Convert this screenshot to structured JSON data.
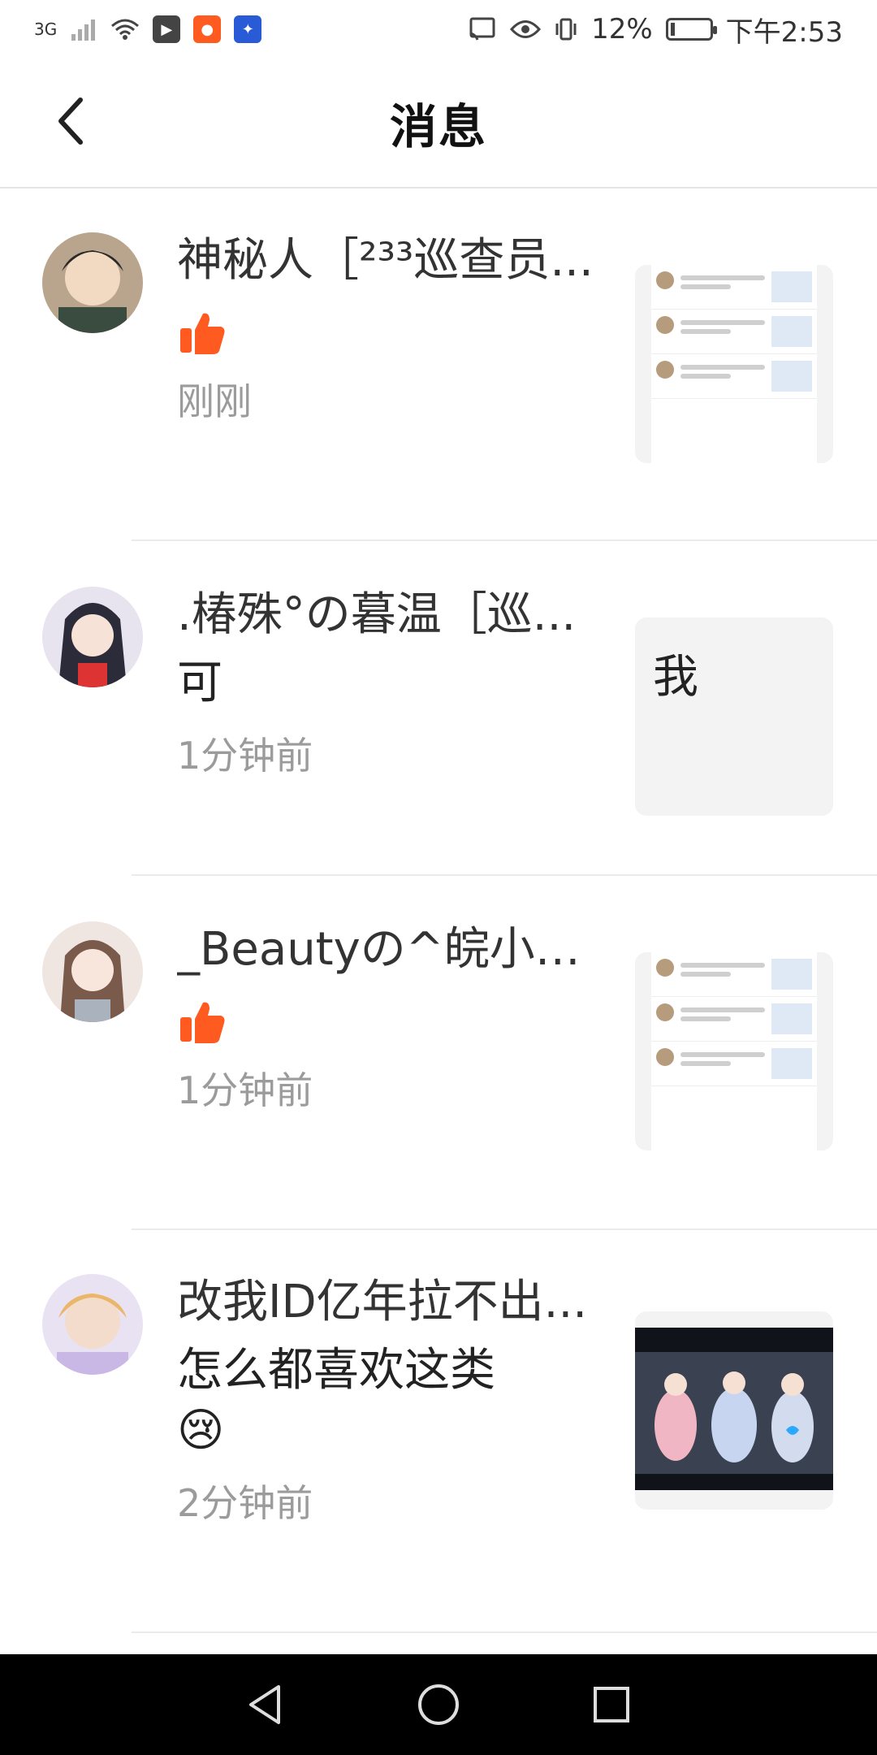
{
  "status_bar": {
    "network": "3G",
    "battery_text": "12%",
    "battery_level_percent": 12,
    "time": "下午2:53"
  },
  "header": {
    "title": "消息"
  },
  "messages": [
    {
      "name": "神秘人［²³³巡查员...",
      "text": "",
      "is_like": true,
      "time": "刚刚",
      "thumb_text": ""
    },
    {
      "name": ".椿殊°の暮温［巡...",
      "text": "可",
      "is_like": false,
      "time": "1分钟前",
      "thumb_text": "我"
    },
    {
      "name": "_Beautyの^皖小夕...",
      "text": "",
      "is_like": true,
      "time": "1分钟前",
      "thumb_text": ""
    },
    {
      "name": "改我ID亿年拉不出...",
      "text": "怎么都喜欢这类",
      "emoji": "😢",
      "is_like": false,
      "time": "2分钟前",
      "thumb_text": ""
    }
  ],
  "icons": {
    "back": "back-arrow-icon",
    "like": "thumbs-up-icon",
    "nav_back": "triangle-back-icon",
    "nav_home": "circle-home-icon",
    "nav_recent": "square-recent-icon"
  },
  "colors": {
    "accent": "#ff5a1f",
    "time_text": "#9b9b9b",
    "nav_bg": "#000000"
  }
}
